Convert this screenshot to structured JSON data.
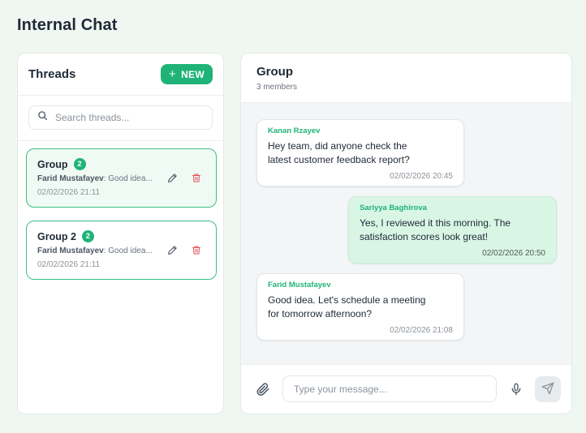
{
  "app": {
    "title": "Internal Chat"
  },
  "threads": {
    "title": "Threads",
    "new_label": "NEW",
    "search_placeholder": "Search threads...",
    "items": [
      {
        "name": "Group",
        "unread": "2",
        "preview_sender": "Farid Mustafayev",
        "preview_text": ": Good idea...",
        "time": "02/02/2026 21:11",
        "active": true
      },
      {
        "name": "Group 2",
        "unread": "2",
        "preview_sender": "Farid Mustafayev",
        "preview_text": ": Good idea...",
        "time": "02/02/2026 21:11",
        "active": false
      }
    ]
  },
  "chat": {
    "title": "Group",
    "subtitle": "3 members",
    "messages": [
      {
        "sender": "Kanan Rzayev",
        "text": "Hey team, did anyone check the latest customer feedback report?",
        "time": "02/02/2026 20:45",
        "direction": "incoming"
      },
      {
        "sender": "Sariyya Baghirova",
        "text": "Yes, I reviewed it this morning. The satisfaction scores look great!",
        "time": "02/02/2026 20:50",
        "direction": "outgoing"
      },
      {
        "sender": "Farid Mustafayev",
        "text": "Good idea. Let's schedule a meeting for tomorrow afternoon?",
        "time": "02/02/2026 21:08",
        "direction": "incoming"
      }
    ],
    "composer_placeholder": "Type your message..."
  },
  "icons": {
    "new": "plus-icon",
    "search": "search-icon",
    "edit": "pencil-icon",
    "delete": "trash-icon",
    "attach": "paperclip-icon",
    "mic": "microphone-icon",
    "send": "send-icon"
  },
  "colors": {
    "accent": "#1fb377",
    "outgoing_bubble": "#d9f6e5",
    "delete": "#e0525a",
    "background": "#f0f7f2"
  }
}
